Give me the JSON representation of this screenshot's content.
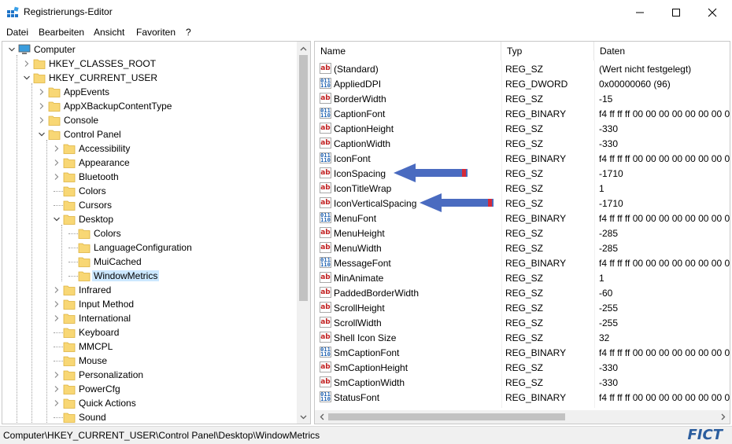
{
  "window": {
    "title": "Registrierungs-Editor"
  },
  "menu": [
    "Datei",
    "Bearbeiten",
    "Ansicht",
    "Favoriten",
    "?"
  ],
  "tree": [
    {
      "label": "Computer",
      "level": 0,
      "expander": "expanded",
      "icon": "computer-icon"
    },
    {
      "label": "HKEY_CLASSES_ROOT",
      "level": 1,
      "expander": "collapsed",
      "icon": "folder-icon"
    },
    {
      "label": "HKEY_CURRENT_USER",
      "level": 1,
      "expander": "expanded",
      "icon": "folder-icon"
    },
    {
      "label": "AppEvents",
      "level": 2,
      "expander": "collapsed",
      "icon": "folder-icon"
    },
    {
      "label": "AppXBackupContentType",
      "level": 2,
      "expander": "collapsed",
      "icon": "folder-icon"
    },
    {
      "label": "Console",
      "level": 2,
      "expander": "collapsed",
      "icon": "folder-icon"
    },
    {
      "label": "Control Panel",
      "level": 2,
      "expander": "expanded",
      "icon": "folder-icon"
    },
    {
      "label": "Accessibility",
      "level": 3,
      "expander": "collapsed",
      "icon": "folder-icon"
    },
    {
      "label": "Appearance",
      "level": 3,
      "expander": "collapsed",
      "icon": "folder-icon"
    },
    {
      "label": "Bluetooth",
      "level": 3,
      "expander": "collapsed",
      "icon": "folder-icon"
    },
    {
      "label": "Colors",
      "level": 3,
      "expander": "none",
      "icon": "folder-icon"
    },
    {
      "label": "Cursors",
      "level": 3,
      "expander": "none",
      "icon": "folder-icon"
    },
    {
      "label": "Desktop",
      "level": 3,
      "expander": "expanded",
      "icon": "folder-icon"
    },
    {
      "label": "Colors",
      "level": 4,
      "expander": "none",
      "icon": "folder-icon"
    },
    {
      "label": "LanguageConfiguration",
      "level": 4,
      "expander": "none",
      "icon": "folder-icon"
    },
    {
      "label": "MuiCached",
      "level": 4,
      "expander": "none",
      "icon": "folder-icon"
    },
    {
      "label": "WindowMetrics",
      "level": 4,
      "expander": "none",
      "icon": "folder-icon",
      "selected": true
    },
    {
      "label": "Infrared",
      "level": 3,
      "expander": "collapsed",
      "icon": "folder-icon"
    },
    {
      "label": "Input Method",
      "level": 3,
      "expander": "collapsed",
      "icon": "folder-icon"
    },
    {
      "label": "International",
      "level": 3,
      "expander": "collapsed",
      "icon": "folder-icon"
    },
    {
      "label": "Keyboard",
      "level": 3,
      "expander": "none",
      "icon": "folder-icon"
    },
    {
      "label": "MMCPL",
      "level": 3,
      "expander": "none",
      "icon": "folder-icon"
    },
    {
      "label": "Mouse",
      "level": 3,
      "expander": "none",
      "icon": "folder-icon"
    },
    {
      "label": "Personalization",
      "level": 3,
      "expander": "collapsed",
      "icon": "folder-icon"
    },
    {
      "label": "PowerCfg",
      "level": 3,
      "expander": "collapsed",
      "icon": "folder-icon"
    },
    {
      "label": "Quick Actions",
      "level": 3,
      "expander": "collapsed",
      "icon": "folder-icon"
    },
    {
      "label": "Sound",
      "level": 3,
      "expander": "none",
      "icon": "folder-icon"
    }
  ],
  "columns": {
    "name": "Name",
    "type": "Typ",
    "data": "Daten"
  },
  "values": [
    {
      "name": "(Standard)",
      "type": "REG_SZ",
      "data": "(Wert nicht festgelegt)",
      "icon": "string-value-icon"
    },
    {
      "name": "AppliedDPI",
      "type": "REG_DWORD",
      "data": "0x00000060 (96)",
      "icon": "binary-value-icon"
    },
    {
      "name": "BorderWidth",
      "type": "REG_SZ",
      "data": "-15",
      "icon": "string-value-icon"
    },
    {
      "name": "CaptionFont",
      "type": "REG_BINARY",
      "data": "f4 ff ff ff 00 00 00 00 00 00 00 00",
      "icon": "binary-value-icon"
    },
    {
      "name": "CaptionHeight",
      "type": "REG_SZ",
      "data": "-330",
      "icon": "string-value-icon"
    },
    {
      "name": "CaptionWidth",
      "type": "REG_SZ",
      "data": "-330",
      "icon": "string-value-icon"
    },
    {
      "name": "IconFont",
      "type": "REG_BINARY",
      "data": "f4 ff ff ff 00 00 00 00 00 00 00 00",
      "icon": "binary-value-icon"
    },
    {
      "name": "IconSpacing",
      "type": "REG_SZ",
      "data": "-1710",
      "icon": "string-value-icon",
      "marked": true
    },
    {
      "name": "IconTitleWrap",
      "type": "REG_SZ",
      "data": "1",
      "icon": "string-value-icon"
    },
    {
      "name": "IconVerticalSpacing",
      "type": "REG_SZ",
      "data": "-1710",
      "icon": "string-value-icon",
      "marked": true
    },
    {
      "name": "MenuFont",
      "type": "REG_BINARY",
      "data": "f4 ff ff ff 00 00 00 00 00 00 00 00",
      "icon": "binary-value-icon"
    },
    {
      "name": "MenuHeight",
      "type": "REG_SZ",
      "data": "-285",
      "icon": "string-value-icon"
    },
    {
      "name": "MenuWidth",
      "type": "REG_SZ",
      "data": "-285",
      "icon": "string-value-icon"
    },
    {
      "name": "MessageFont",
      "type": "REG_BINARY",
      "data": "f4 ff ff ff 00 00 00 00 00 00 00 00",
      "icon": "binary-value-icon"
    },
    {
      "name": "MinAnimate",
      "type": "REG_SZ",
      "data": "1",
      "icon": "string-value-icon"
    },
    {
      "name": "PaddedBorderWidth",
      "type": "REG_SZ",
      "data": "-60",
      "icon": "string-value-icon"
    },
    {
      "name": "ScrollHeight",
      "type": "REG_SZ",
      "data": "-255",
      "icon": "string-value-icon"
    },
    {
      "name": "ScrollWidth",
      "type": "REG_SZ",
      "data": "-255",
      "icon": "string-value-icon"
    },
    {
      "name": "Shell Icon Size",
      "type": "REG_SZ",
      "data": "32",
      "icon": "string-value-icon"
    },
    {
      "name": "SmCaptionFont",
      "type": "REG_BINARY",
      "data": "f4 ff ff ff 00 00 00 00 00 00 00 00",
      "icon": "binary-value-icon"
    },
    {
      "name": "SmCaptionHeight",
      "type": "REG_SZ",
      "data": "-330",
      "icon": "string-value-icon"
    },
    {
      "name": "SmCaptionWidth",
      "type": "REG_SZ",
      "data": "-330",
      "icon": "string-value-icon"
    },
    {
      "name": "StatusFont",
      "type": "REG_BINARY",
      "data": "f4 ff ff ff 00 00 00 00 00 00 00 00",
      "icon": "binary-value-icon"
    }
  ],
  "status": {
    "path": "Computer\\HKEY_CURRENT_USER\\Control Panel\\Desktop\\WindowMetrics"
  },
  "watermark": "FICT",
  "colors": {
    "selection": "#cce8ff",
    "arrow": "#4a6bc0",
    "arrow_tail": "#d42a3a",
    "watermark": "#2b5d9e",
    "folder": "#f8d775"
  }
}
